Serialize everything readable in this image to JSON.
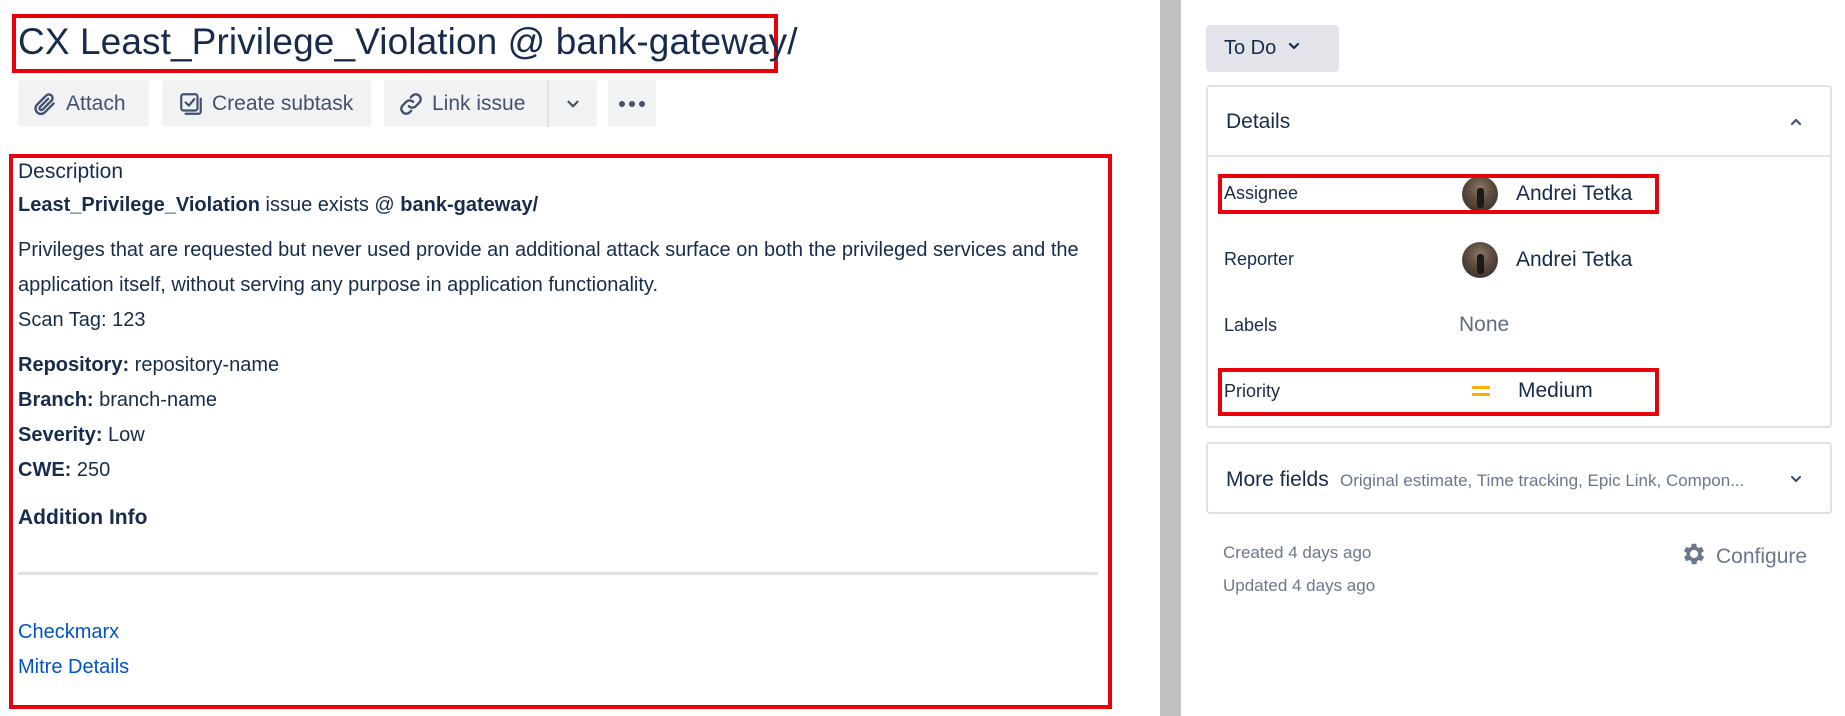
{
  "issue": {
    "title": "CX Least_Privilege_Violation @ bank-gateway/"
  },
  "toolbar": {
    "attach_label": "Attach",
    "create_subtask_label": "Create subtask",
    "link_issue_label": "Link issue"
  },
  "description": {
    "heading": "Description",
    "issue_name": "Least_Privilege_Violation",
    "issue_middle": " issue exists @ ",
    "issue_target": "bank-gateway/",
    "paragraph": "Privileges that are requested but never used provide an additional attack surface on both the privileged services and the application itself, without serving any purpose in application functionality.",
    "scan_tag": "Scan Tag: 123",
    "fields": [
      {
        "label": "Repository:",
        "value": " repository-name"
      },
      {
        "label": "Branch:",
        "value": " branch-name"
      },
      {
        "label": "Severity:",
        "value": " Low"
      },
      {
        "label": "CWE:",
        "value": " 250"
      }
    ],
    "addition_info": "Addition Info",
    "links": [
      "Checkmarx",
      "Mitre Details"
    ]
  },
  "status": {
    "label": "To Do"
  },
  "details": {
    "title": "Details",
    "assignee": {
      "label": "Assignee",
      "value": "Andrei Tetka"
    },
    "reporter": {
      "label": "Reporter",
      "value": "Andrei Tetka"
    },
    "labels": {
      "label": "Labels",
      "value": "None"
    },
    "priority": {
      "label": "Priority",
      "value": "Medium",
      "color": "#ffab00"
    }
  },
  "more_fields": {
    "title": "More fields",
    "summary": "Original estimate, Time tracking, Epic Link, Compon..."
  },
  "meta": {
    "created": "Created 4 days ago",
    "updated": "Updated 4 days ago",
    "configure_label": "Configure"
  },
  "colors": {
    "highlight": "#e8000b",
    "link": "#0052cc",
    "text": "#172b4d",
    "priority_medium": "#ffab00"
  }
}
